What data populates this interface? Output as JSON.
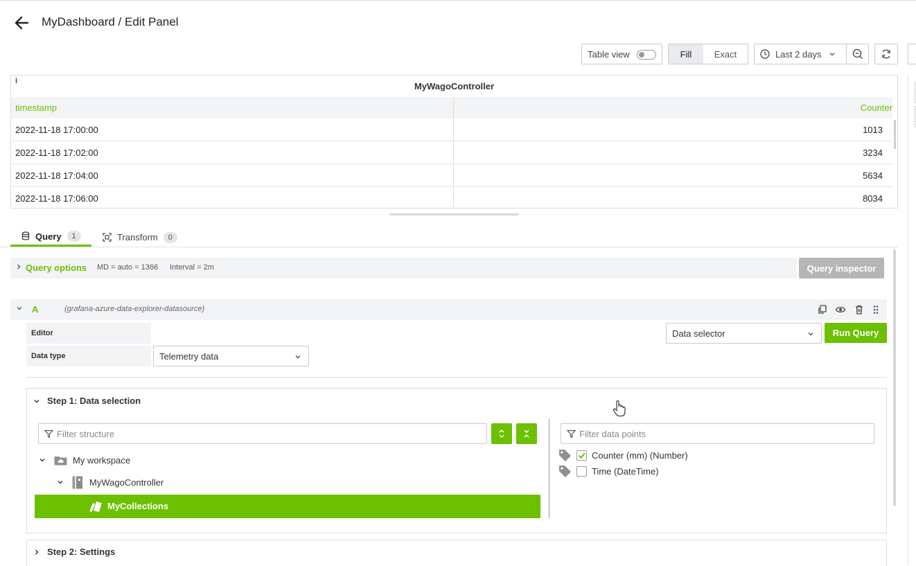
{
  "header": {
    "title": "MyDashboard / Edit Panel"
  },
  "toolbar": {
    "table_view_label": "Table view",
    "fill_label": "Fill",
    "exact_label": "Exact",
    "time_range": "Last 2 days"
  },
  "panel": {
    "info": "i",
    "title": "MyWagoController",
    "columns": [
      "timestamp",
      "Counter"
    ],
    "rows": [
      {
        "timestamp": "2022-11-18 17:00:00",
        "counter": "1013"
      },
      {
        "timestamp": "2022-11-18 17:02:00",
        "counter": "3234"
      },
      {
        "timestamp": "2022-11-18 17:04:00",
        "counter": "5634"
      },
      {
        "timestamp": "2022-11-18 17:06:00",
        "counter": "8034"
      }
    ]
  },
  "tabs": [
    {
      "label": "Query",
      "count": "1"
    },
    {
      "label": "Transform",
      "count": "0"
    }
  ],
  "query_options": {
    "label": "Query options",
    "md": "MD = auto = 1366",
    "interval": "Interval = 2m",
    "inspector_label": "Query inspector"
  },
  "query_a": {
    "letter": "A",
    "datasource": "(grafana-azure-data-explorer-datasource)",
    "editor_label": "Editor",
    "editor_mode": "Data selector",
    "run_label": "Run Query",
    "data_type_label": "Data type",
    "data_type": "Telemetry data"
  },
  "step1": {
    "title": "Step 1: Data selection",
    "filter_structure_placeholder": "Filter structure",
    "filter_points_placeholder": "Filter data points",
    "tree": {
      "workspace": "My workspace",
      "controller": "MyWagoController",
      "collections": "MyCollections"
    },
    "data_points": [
      {
        "label": "Counter (mm) (Number)",
        "checked": true
      },
      {
        "label": "Time (DateTime)",
        "checked": false
      }
    ]
  },
  "step2": {
    "title": "Step 2: Settings"
  },
  "colors": {
    "accent": "#6cc000",
    "inspector_disabled": "#b6b6b6"
  }
}
